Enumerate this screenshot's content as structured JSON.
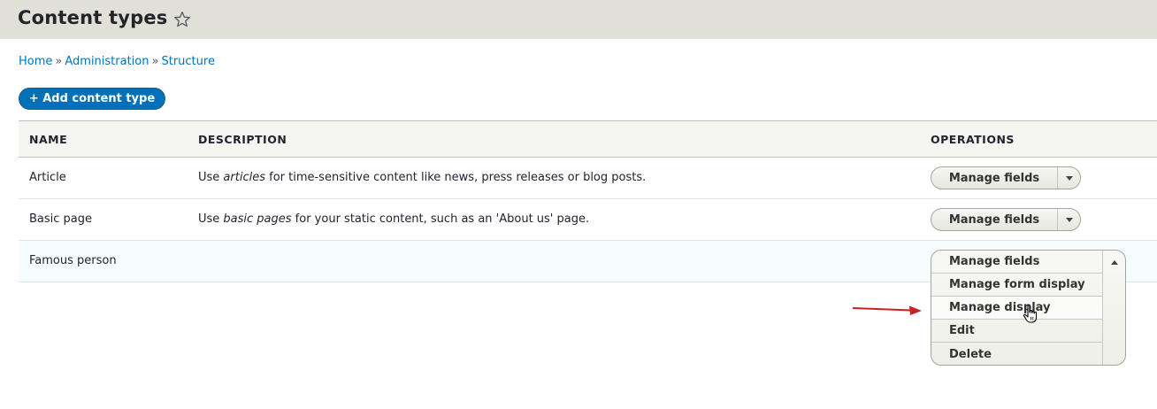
{
  "header": {
    "title": "Content types",
    "favorite_icon": "star-outline-icon"
  },
  "breadcrumb": [
    "Home",
    "Administration",
    "Structure"
  ],
  "breadcrumb_separator": "»",
  "add_button": {
    "label": "+ Add content type"
  },
  "table": {
    "columns": [
      "NAME",
      "DESCRIPTION",
      "OPERATIONS"
    ],
    "rows": [
      {
        "name": "Article",
        "desc_pre": "Use ",
        "desc_em": "articles",
        "desc_post": " for time-sensitive content like news, press releases or blog posts.",
        "operation": "Manage fields"
      },
      {
        "name": "Basic page",
        "desc_pre": "Use ",
        "desc_em": "basic pages",
        "desc_post": " for your static content, such as an 'About us' page.",
        "operation": "Manage fields"
      },
      {
        "name": "Famous person",
        "desc_pre": "",
        "desc_em": "",
        "desc_post": "",
        "operation": "Manage fields"
      }
    ]
  },
  "dropdown": {
    "items": [
      "Manage fields",
      "Manage form display",
      "Manage display",
      "Edit",
      "Delete"
    ],
    "hovered": "Manage display"
  },
  "colors": {
    "link": "#0074bd",
    "primary_button": "#0071b8",
    "header_bg": "#e0dfd8",
    "annotation_arrow": "#cc1f1f"
  }
}
